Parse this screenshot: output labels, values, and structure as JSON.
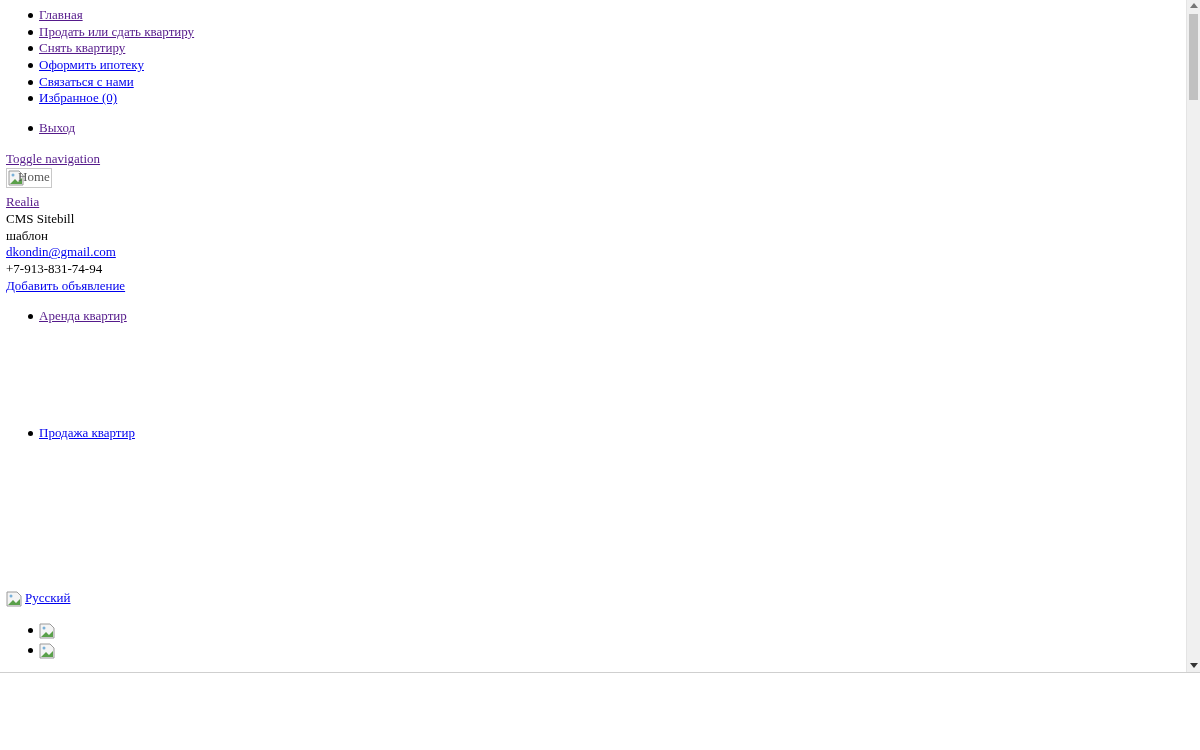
{
  "top_menu": [
    {
      "label": "Главная",
      "visited": true
    },
    {
      "label": "Продать или сдать квартиру",
      "visited": true
    },
    {
      "label": "Снять квартиру",
      "visited": true
    },
    {
      "label": "Оформить ипотеку",
      "visited": false
    },
    {
      "label": "Связаться с нами",
      "visited": false
    },
    {
      "label": "Избранное (0)",
      "visited": false
    }
  ],
  "account_menu": [
    {
      "label": "Выход",
      "visited": true
    }
  ],
  "toggle_link": {
    "label": "Toggle navigation",
    "visited": true
  },
  "logo_image": {
    "alt": "Home"
  },
  "brand_link": {
    "label": "Realia",
    "visited": true
  },
  "site_texts": [
    "CMS Sitebill",
    "шаблон"
  ],
  "email_link": {
    "label": "dkondin@gmail.com",
    "visited": false
  },
  "phone": "+7-913-831-74-94",
  "add_listing_link": {
    "label": "Добавить объявление",
    "visited": false
  },
  "category_menus": [
    {
      "label": "Аренда квартир",
      "visited": true
    },
    {
      "label": "Продажа квартир",
      "visited": false
    }
  ],
  "language_link": {
    "label": "Русский",
    "visited": false
  },
  "flag_images": [
    {
      "kind": "broken_image"
    },
    {
      "kind": "broken_image"
    }
  ]
}
